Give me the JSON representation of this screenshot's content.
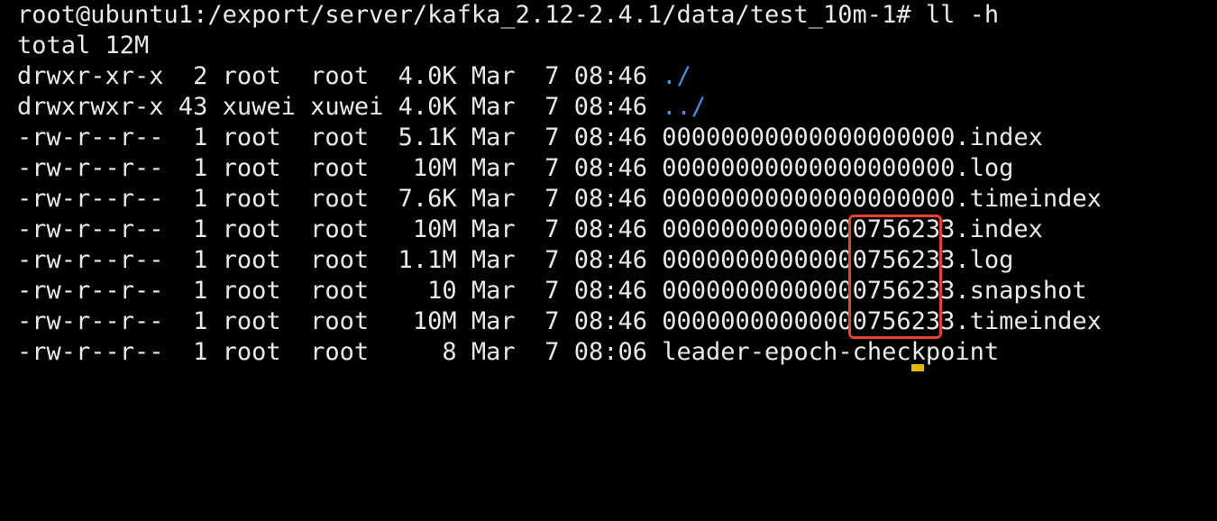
{
  "terminal": {
    "prompt": "root@ubuntu1:/export/server/kafka_2.12-2.4.1/data/test_10m-1# ll -h",
    "total": "total 12M",
    "rows": [
      {
        "meta": "drwxr-xr-x  2 root  root  4.0K Mar  7 08:46 ",
        "name": "./",
        "is_dir": true
      },
      {
        "meta": "drwxrwxr-x 43 xuwei xuwei 4.0K Mar  7 08:46 ",
        "name": "../",
        "is_dir": true
      },
      {
        "meta": "-rw-r--r--  1 root  root  5.1K Mar  7 08:46 ",
        "name": "00000000000000000000.index",
        "is_dir": false
      },
      {
        "meta": "-rw-r--r--  1 root  root   10M Mar  7 08:46 ",
        "name": "00000000000000000000.log",
        "is_dir": false
      },
      {
        "meta": "-rw-r--r--  1 root  root  7.6K Mar  7 08:46 ",
        "name": "00000000000000000000.timeindex",
        "is_dir": false
      },
      {
        "meta": "-rw-r--r--  1 root  root   10M Mar  7 08:46 ",
        "name": "00000000000000756233.index",
        "is_dir": false
      },
      {
        "meta": "-rw-r--r--  1 root  root  1.1M Mar  7 08:46 ",
        "name": "00000000000000756233.log",
        "is_dir": false
      },
      {
        "meta": "-rw-r--r--  1 root  root    10 Mar  7 08:46 ",
        "name": "00000000000000756233.snapshot",
        "is_dir": false
      },
      {
        "meta": "-rw-r--r--  1 root  root   10M Mar  7 08:46 ",
        "name": "00000000000000756233.timeindex",
        "is_dir": false
      },
      {
        "meta": "-rw-r--r--  1 root  root     8 Mar  7 08:06 ",
        "name": "leader-epoch-checkpoint",
        "is_dir": false
      }
    ]
  },
  "colors": {
    "background": "#000000",
    "text": "#e9e9e9",
    "directory": "#4a8fe6",
    "highlight_box": "#e8412c",
    "cursor": "#e6b800"
  }
}
